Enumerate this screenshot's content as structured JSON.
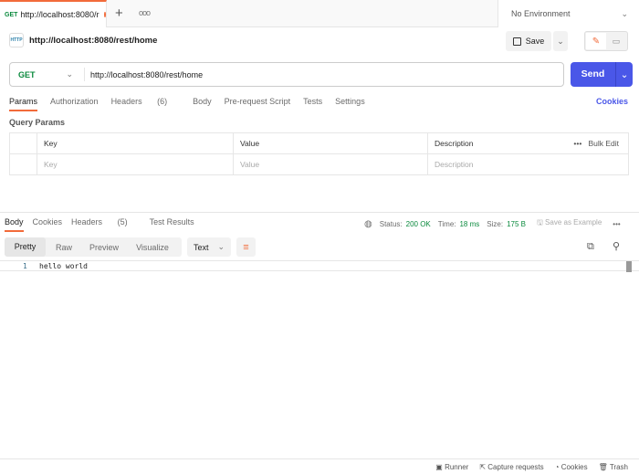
{
  "tabbar": {
    "tab_method": "GET",
    "tab_title": "http://localhost:8080/r",
    "add_icon": "plus-icon",
    "more_icon": "ellipsis-icon",
    "environment": "No Environment"
  },
  "request": {
    "title": "http://localhost:8080/rest/home",
    "save_label": "Save",
    "method": "GET",
    "url": "http://localhost:8080/rest/home",
    "send_label": "Send"
  },
  "req_tabs": [
    {
      "label": "Params"
    },
    {
      "label": "Authorization"
    },
    {
      "label": "Headers",
      "count": "(6)"
    },
    {
      "label": "Body"
    },
    {
      "label": "Pre-request Script"
    },
    {
      "label": "Tests"
    },
    {
      "label": "Settings"
    }
  ],
  "cookies_link": "Cookies",
  "params": {
    "heading": "Query Params",
    "columns": [
      "Key",
      "Value",
      "Description"
    ],
    "bulk_edit": "Bulk Edit",
    "placeholders": [
      "Key",
      "Value",
      "Description"
    ]
  },
  "response": {
    "tabs": [
      {
        "label": "Body"
      },
      {
        "label": "Cookies"
      },
      {
        "label": "Headers",
        "count": "(5)"
      },
      {
        "label": "Test Results"
      }
    ],
    "status_label": "Status:",
    "status": "200 OK",
    "time_label": "Time:",
    "time": "18 ms",
    "size_label": "Size:",
    "size": "175 B",
    "save_example": "Save as Example",
    "views": [
      "Pretty",
      "Raw",
      "Preview",
      "Visualize"
    ],
    "format": "Text",
    "line_no": "1",
    "body": "hello world"
  },
  "footer": [
    "Runner",
    "Capture requests",
    "Cookies",
    "Trash"
  ],
  "colors": {
    "accent": "#f26b3a",
    "send": "#4a57e8",
    "success": "#0b8a3e"
  }
}
